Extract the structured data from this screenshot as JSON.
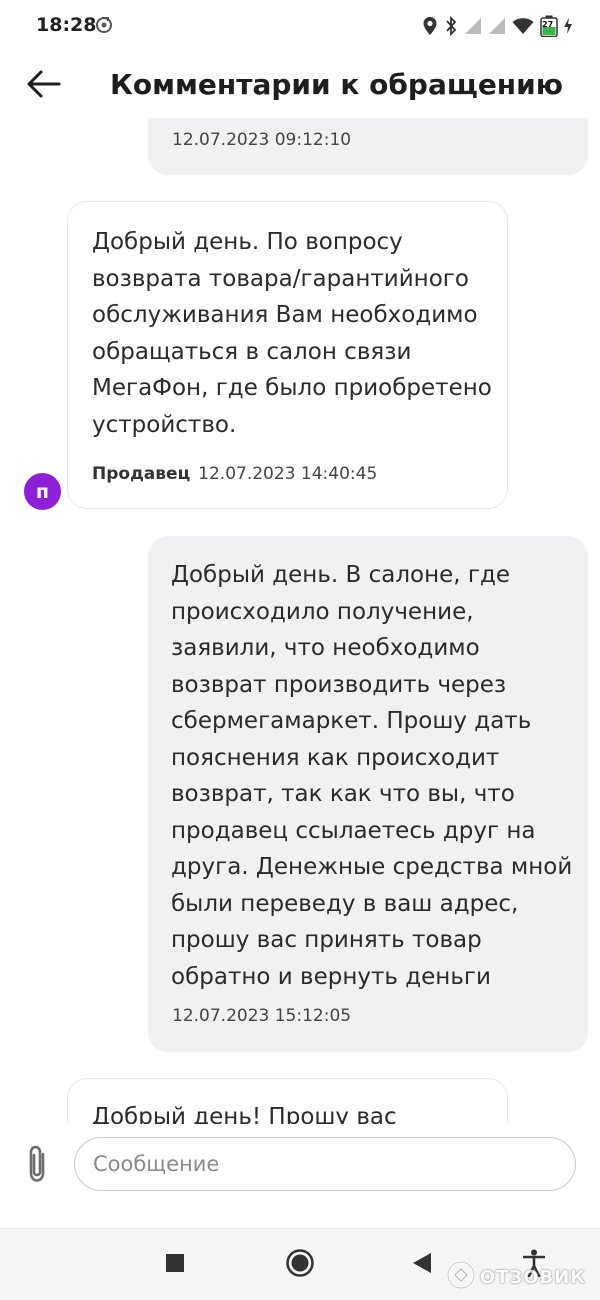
{
  "status_bar": {
    "time": "18:28",
    "battery_level": "27"
  },
  "header": {
    "title": "Комментарии к обращению"
  },
  "messages": [
    {
      "sender": "user",
      "text_lines": [],
      "timestamp": "12.07.2023 09:12:10"
    },
    {
      "sender": "seller",
      "author": "Продавец",
      "avatar_letter": "п",
      "text_lines": [
        "Добрый день. По вопросу",
        "возврата товара/гарантийного",
        "обслуживания Вам необходимо",
        "обращаться в салон связи",
        "МегаФон, где было приобретено",
        "устройство."
      ],
      "timestamp": "12.07.2023 14:40:45"
    },
    {
      "sender": "user",
      "text_lines": [
        "Добрый день. В салоне, где",
        "происходило получение,",
        "заявили, что необходимо",
        "возврат производить через",
        "сбермегамаркет. Прошу дать",
        "пояснения как происходит",
        "возврат, так как что вы, что",
        "продавец ссылаетесь друг на",
        "друга. Денежные средства мной",
        "были переведу в ваш адрес,",
        "прошу вас принять товар",
        "обратно и вернуть деньги"
      ],
      "timestamp": "12.07.2023 15:12:05"
    },
    {
      "sender": "seller",
      "text_lines": [
        "Добрый день! Прошу вас"
      ]
    }
  ],
  "composer": {
    "placeholder": "Сообщение"
  },
  "watermark": {
    "text": "ОТЗОВИК"
  },
  "icons": {
    "back": "arrow-left-icon",
    "attach": "paperclip-icon",
    "nav_recents": "square-icon",
    "nav_home": "circle-icon",
    "nav_back": "triangle-left-icon",
    "nav_accessibility": "accessibility-icon"
  },
  "colors": {
    "avatar": "#8e1fd9",
    "user_bubble": "#f1f1f4",
    "seller_bubble_border": "#e8e8ec"
  }
}
